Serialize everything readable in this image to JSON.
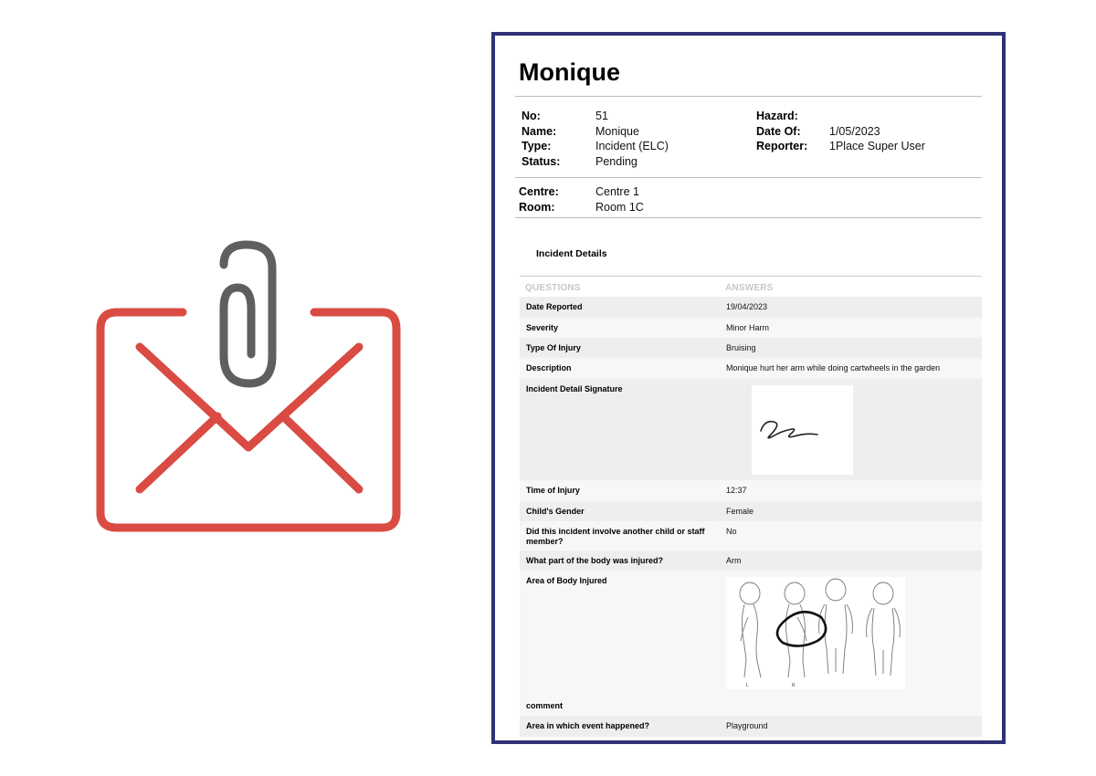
{
  "icons": {
    "envelope": "envelope-icon",
    "paperclip": "paperclip-icon"
  },
  "colors": {
    "envelope": "#d94b43",
    "paperclip": "#5f5f5f",
    "frame": "#2f3275"
  },
  "report": {
    "title": "Monique",
    "fields": {
      "no_label": "No:",
      "no_value": "51",
      "name_label": "Name:",
      "name_value": "Monique",
      "type_label": "Type:",
      "type_value": "Incident (ELC)",
      "status_label": "Status:",
      "status_value": "Pending",
      "hazard_label": "Hazard:",
      "hazard_value": "",
      "date_label": "Date Of:",
      "date_value": "1/05/2023",
      "reporter_label": "Reporter:",
      "reporter_value": "1Place Super User",
      "centre_label": "Centre:",
      "centre_value": "Centre 1",
      "room_label": "Room:",
      "room_value": "Room 1C"
    },
    "section_title": "Incident Details",
    "table": {
      "col_questions": "QUESTIONS",
      "col_answers": "ANSWERS",
      "rows": [
        {
          "q": "Date Reported",
          "a": "19/04/2023"
        },
        {
          "q": "Severity",
          "a": "Minor Harm"
        },
        {
          "q": "Type Of Injury",
          "a": "Bruising"
        },
        {
          "q": "Description",
          "a": "Monique hurt her arm while doing cartwheels in the garden"
        },
        {
          "q": "Incident Detail Signature",
          "a": ""
        },
        {
          "q": "Time of Injury",
          "a": "12:37"
        },
        {
          "q": "Child's Gender",
          "a": "Female"
        },
        {
          "q": "Did this incident involve another child or staff member?",
          "a": "No"
        },
        {
          "q": "What part of the body was injured?",
          "a": "Arm"
        },
        {
          "q": "Area of Body Injured",
          "a": ""
        },
        {
          "q": "comment",
          "a": ""
        },
        {
          "q": "Area in which event happened?",
          "a": "Playground"
        }
      ]
    },
    "diagram_marks": {
      "left_label": "L",
      "right_label": "R"
    }
  }
}
